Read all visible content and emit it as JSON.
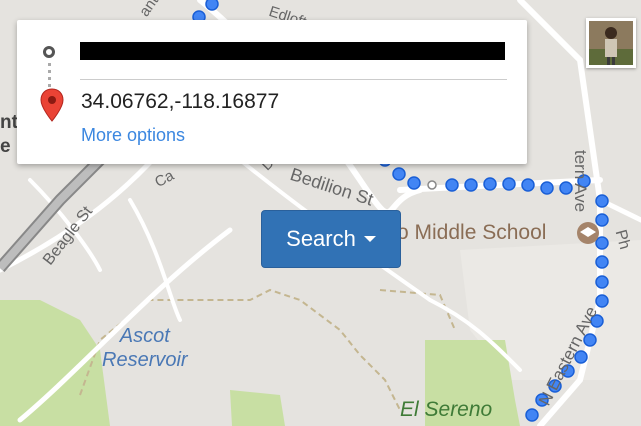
{
  "directions": {
    "origin_redacted": true,
    "destination": "34.06762,-118.16877",
    "more_options": "More options"
  },
  "search_button": {
    "label": "Search"
  },
  "map_labels": {
    "ascot_reservoir": "Ascot\nReservoir",
    "el_sereno": "El Sereno",
    "middle_school": "o Middle School",
    "bedilion_st": "Bedilion St",
    "beagle_st": "Beagle St",
    "n_eastern_ave": "N Eastern Ave",
    "tern_ave": "tern Ave",
    "ca": "Ca",
    "d": "D",
    "edloft": "Edloft",
    "anti": "anti",
    "nti": "nti",
    "e": "e",
    "ph": "Ph"
  },
  "colors": {
    "route": "#4285f4",
    "park": "#c8dfa3",
    "button": "#3172b5",
    "link": "#3b87e0",
    "pin": "#ea4335"
  }
}
